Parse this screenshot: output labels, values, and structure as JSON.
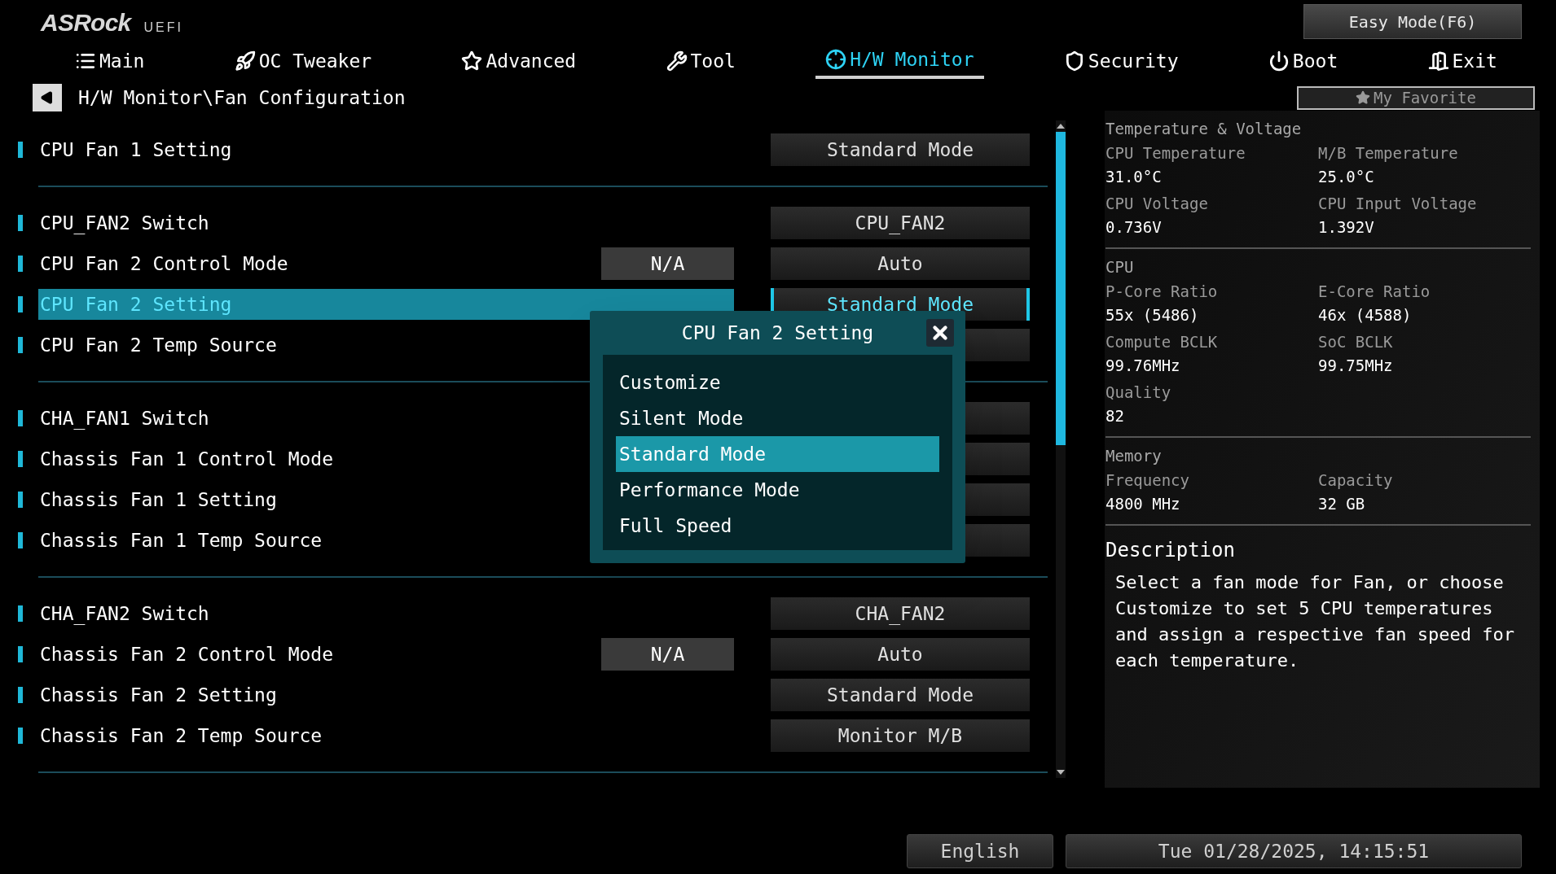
{
  "header": {
    "logo": "ASRock",
    "logo_sub": "UEFI",
    "easy_mode": "Easy Mode(F6)",
    "my_favorite": "My Favorite"
  },
  "tabs": [
    {
      "label": "Main",
      "selected": false
    },
    {
      "label": "OC Tweaker",
      "selected": false
    },
    {
      "label": "Advanced",
      "selected": false
    },
    {
      "label": "Tool",
      "selected": false
    },
    {
      "label": "H/W Monitor",
      "selected": true
    },
    {
      "label": "Security",
      "selected": false
    },
    {
      "label": "Boot",
      "selected": false
    },
    {
      "label": "Exit",
      "selected": false
    }
  ],
  "breadcrumb": "H/W Monitor\\Fan Configuration",
  "groups": [
    {
      "rows": [
        {
          "label": "CPU Fan 1 Setting",
          "value": "Standard Mode",
          "selected": false
        }
      ]
    },
    {
      "rows": [
        {
          "label": "CPU_FAN2 Switch",
          "value": "CPU_FAN2",
          "selected": false
        },
        {
          "label": "CPU Fan 2 Control Mode",
          "na": "N/A",
          "value": "Auto",
          "selected": false
        },
        {
          "label": "CPU Fan 2 Setting",
          "value": "Standard Mode",
          "selected": true
        },
        {
          "label": "CPU Fan 2 Temp Source",
          "selected": false
        }
      ]
    },
    {
      "rows": [
        {
          "label": "CHA_FAN1 Switch",
          "selected": false
        },
        {
          "label": "Chassis Fan 1 Control Mode",
          "selected": false
        },
        {
          "label": "Chassis Fan 1 Setting",
          "selected": false
        },
        {
          "label": "Chassis Fan 1 Temp Source",
          "selected": false
        }
      ]
    },
    {
      "rows": [
        {
          "label": "CHA_FAN2 Switch",
          "value": "CHA_FAN2",
          "selected": false
        },
        {
          "label": "Chassis Fan 2 Control Mode",
          "na": "N/A",
          "value": "Auto",
          "selected": false
        },
        {
          "label": "Chassis Fan 2 Setting",
          "value": "Standard Mode",
          "selected": false
        },
        {
          "label": "Chassis Fan 2 Temp Source",
          "value": "Monitor M/B",
          "selected": false
        }
      ]
    }
  ],
  "popup": {
    "title": "CPU Fan 2 Setting",
    "options": [
      {
        "label": "Customize",
        "selected": false
      },
      {
        "label": "Silent Mode",
        "selected": false
      },
      {
        "label": "Standard Mode",
        "selected": true
      },
      {
        "label": "Performance Mode",
        "selected": false
      },
      {
        "label": "Full Speed",
        "selected": false
      }
    ]
  },
  "info": [
    {
      "title": "Temperature & Voltage",
      "items": [
        {
          "label": "CPU Temperature",
          "value": "31.0°C"
        },
        {
          "label": "M/B Temperature",
          "value": "25.0°C"
        },
        {
          "label": "CPU Voltage",
          "value": "0.736V"
        },
        {
          "label": "CPU Input Voltage",
          "value": "1.392V"
        }
      ]
    },
    {
      "title": "CPU",
      "items": [
        {
          "label": "P-Core Ratio",
          "value": "55x (5486)"
        },
        {
          "label": "E-Core Ratio",
          "value": "46x (4588)"
        },
        {
          "label": "Compute BCLK",
          "value": "99.76MHz"
        },
        {
          "label": "SoC BCLK",
          "value": "99.75MHz"
        },
        {
          "label": "Quality",
          "value": "82"
        }
      ]
    },
    {
      "title": "Memory",
      "items": [
        {
          "label": "Frequency",
          "value": "4800 MHz"
        },
        {
          "label": "Capacity",
          "value": "32 GB"
        }
      ]
    }
  ],
  "description": {
    "title": "Description",
    "text": "Select a fan mode for Fan, or choose Customize to set 5 CPU temperatures and assign a respective fan speed for each temperature."
  },
  "footer": {
    "language": "English",
    "datetime": "Tue 01/28/2025, 14:15:51"
  }
}
